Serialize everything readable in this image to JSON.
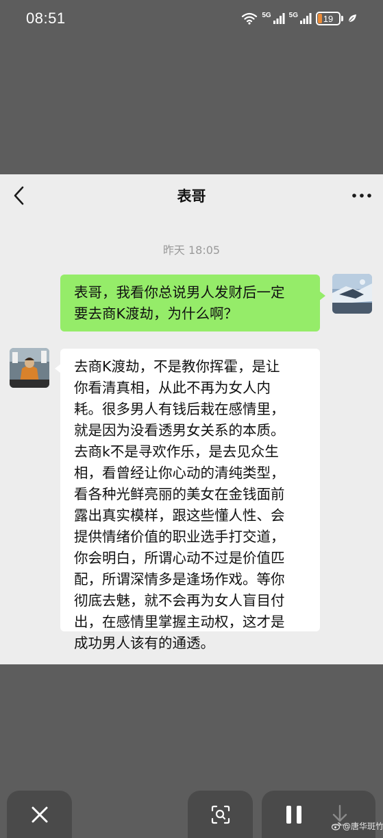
{
  "status_bar": {
    "time": "08:51",
    "network_1": "5G",
    "network_2": "5G",
    "battery": "19",
    "battery_level": 0.19
  },
  "chat": {
    "title": "表哥",
    "timestamp": "昨天 18:05",
    "sent_message": {
      "lines": [
        "表哥，我看你总说男人发财后一定",
        "要去商K渡劫，为什么啊？"
      ]
    },
    "received_message": {
      "lines": [
        "去商K渡劫，不是教你挥霍，是让",
        "你看清真相，从此不再为女人内",
        "耗。很多男人有钱后栽在感情里，",
        "就是因为没看透男女关系的本质。",
        "去商k不是寻欢作乐，是去见众生",
        "相，看曾经让你心动的清纯类型，",
        "看各种光鲜亮丽的美女在金钱面前",
        "露出真实模样，跟这些懂人性、会",
        "提供情绪价值的职业选手打交道，",
        "你会明白，所谓心动不过是价值匹",
        "配，所谓深情多是逢场作戏。等你",
        "彻底去魅，就不会再为女人盲目付",
        "出，在感情里掌握主动权，这才是",
        "成功男人该有的通透。"
      ]
    }
  },
  "watermark": {
    "text": "@唐华斑竹"
  },
  "colors": {
    "sent_bubble": "#95ec69",
    "received_bubble": "#ffffff",
    "chat_background": "#ededed",
    "viewer_background": "#5d5d5d",
    "battery_accent": "#e98a37"
  },
  "icons": {
    "back": "chevron-left-icon",
    "more": "more-dots-icon",
    "close": "close-icon",
    "scan": "scan-icon",
    "pause": "pause-icon",
    "download": "download-icon"
  }
}
